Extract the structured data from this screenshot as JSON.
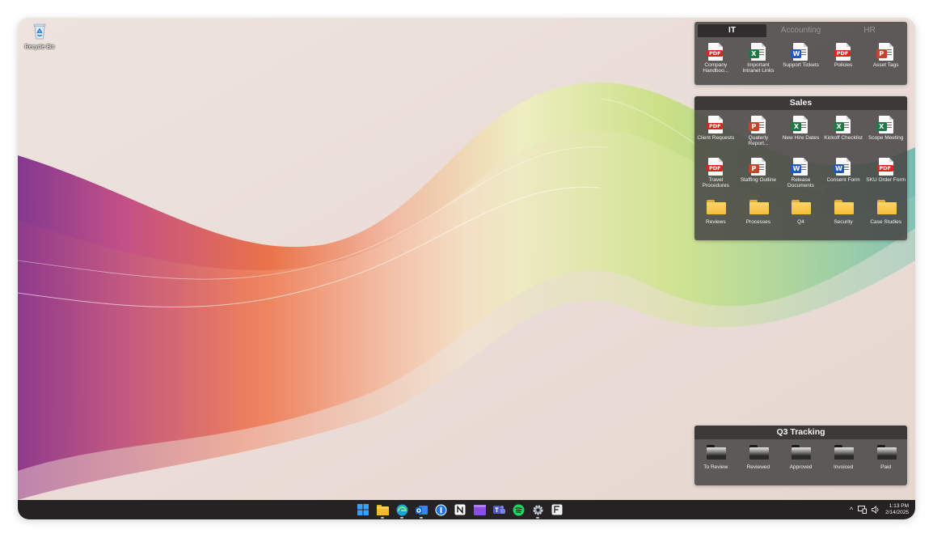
{
  "desktop": {
    "recycle_bin_label": "Recycle Bin"
  },
  "fences": {
    "it_group": {
      "tabs": [
        {
          "label": "IT",
          "active": true
        },
        {
          "label": "Accounting",
          "active": false
        },
        {
          "label": "HR",
          "active": false
        }
      ],
      "items": [
        {
          "type": "pdf",
          "label": "Company Handboo..."
        },
        {
          "type": "xls",
          "label": "Important Intranet Links"
        },
        {
          "type": "doc",
          "label": "Support Tickets"
        },
        {
          "type": "pdf",
          "label": "Policies"
        },
        {
          "type": "ppt",
          "label": "Asset Tags"
        }
      ]
    },
    "sales": {
      "title": "Sales",
      "items": [
        {
          "type": "pdf",
          "label": "Client Requests"
        },
        {
          "type": "ppt",
          "label": "Quaterly Report..."
        },
        {
          "type": "xls",
          "label": "New Hire Dates"
        },
        {
          "type": "xls",
          "label": "Kickoff Checklist"
        },
        {
          "type": "xls",
          "label": "Scope Meeting"
        },
        {
          "type": "pdf",
          "label": "Travel Procedures"
        },
        {
          "type": "ppt",
          "label": "Staffing Outline"
        },
        {
          "type": "doc",
          "label": "Release Documents"
        },
        {
          "type": "doc",
          "label": "Consent Form"
        },
        {
          "type": "pdf",
          "label": "SKU Order Form"
        },
        {
          "type": "folder",
          "label": "Reviews"
        },
        {
          "type": "folder",
          "label": "Processes"
        },
        {
          "type": "folder",
          "label": "Q4"
        },
        {
          "type": "folder",
          "label": "Security"
        },
        {
          "type": "folder",
          "label": "Case Studies"
        }
      ]
    },
    "q3": {
      "title": "Q3 Tracking",
      "items": [
        {
          "type": "folder-dark",
          "label": "To Review"
        },
        {
          "type": "folder-dark",
          "label": "Reviewed"
        },
        {
          "type": "folder-dark",
          "label": "Approved"
        },
        {
          "type": "folder-dark",
          "label": "Invoiced"
        },
        {
          "type": "folder-dark",
          "label": "Paid"
        }
      ]
    }
  },
  "badges": {
    "pdf": "PDF",
    "xls": "X",
    "doc": "W",
    "ppt": "P"
  },
  "taskbar": {
    "apps": [
      {
        "name": "start-button",
        "icon": "windows-icon",
        "running": false
      },
      {
        "name": "file-explorer-button",
        "icon": "folder-icon",
        "running": true
      },
      {
        "name": "edge-button",
        "icon": "edge-icon",
        "running": true
      },
      {
        "name": "outlook-button",
        "icon": "outlook-icon",
        "running": true
      },
      {
        "name": "onepassword-button",
        "icon": "password-icon",
        "running": false
      },
      {
        "name": "notion-button",
        "icon": "notion-icon",
        "running": false
      },
      {
        "name": "clipchamp-button",
        "icon": "video-icon",
        "running": false
      },
      {
        "name": "teams-button",
        "icon": "teams-icon",
        "running": false
      },
      {
        "name": "spotify-button",
        "icon": "spotify-icon",
        "running": false
      },
      {
        "name": "settings-button",
        "icon": "gear-icon",
        "running": true
      },
      {
        "name": "fences-button",
        "icon": "fences-icon",
        "running": false
      }
    ],
    "tray": {
      "chevron": "^",
      "time": "1:13 PM",
      "date": "2/14/2025"
    }
  },
  "colors": {
    "pdf": "#d9261c",
    "xls": "#1e7a45",
    "doc": "#1f56c8",
    "ppt": "#c8432a",
    "fence_bg": "#464444",
    "taskbar_bg": "#262223"
  }
}
